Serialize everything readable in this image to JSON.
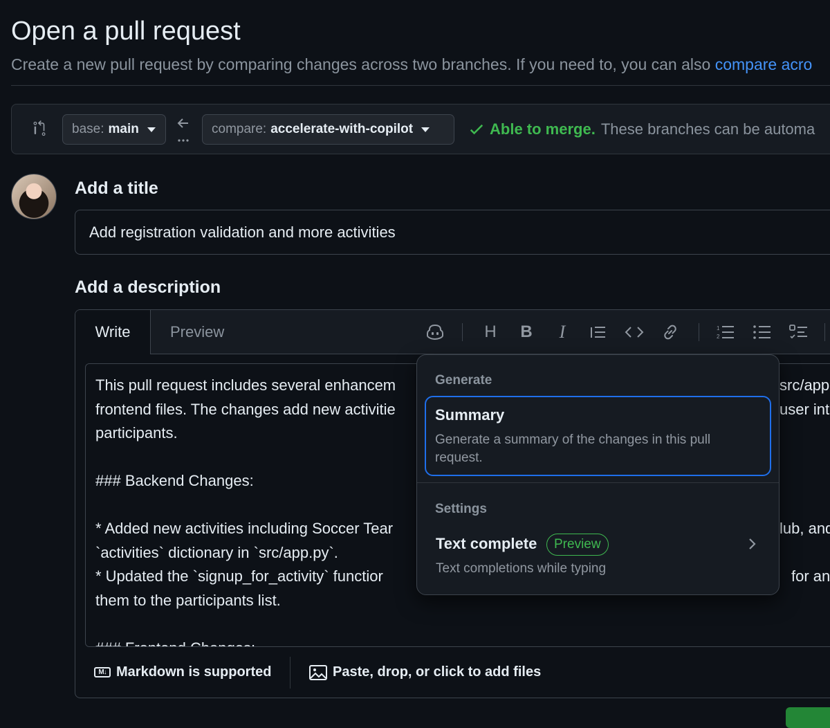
{
  "header": {
    "title": "Open a pull request",
    "subtitle_text": "Create a new pull request by comparing changes across two branches. If you need to, you can also ",
    "subtitle_link": "compare acro"
  },
  "compare_bar": {
    "base_key": "base:",
    "base_value": "main",
    "compare_key": "compare:",
    "compare_value": "accelerate-with-copilot",
    "status_ok": "Able to merge.",
    "status_rest": "These branches can be automa"
  },
  "title_section": {
    "heading": "Add a title",
    "value": "Add registration validation and more activities"
  },
  "description_section": {
    "heading": "Add a description",
    "tabs": {
      "write": "Write",
      "preview": "Preview"
    },
    "toolbar": {
      "heading": "H",
      "bold": "B",
      "italic": "I"
    },
    "body_lines": [
      "This pull request includes several enhancem",
      "frontend files. The changes add new activitie",
      "participants.",
      "",
      "### Backend Changes:",
      "",
      "* Added new activities including Soccer Tear",
      "`activities` dictionary in `src/app.py`.",
      "* Updated the `signup_for_activity` functior",
      "them to the participants list.",
      "",
      "### Frontend Changes:"
    ],
    "body_right_fragments": [
      "src/app",
      "user into",
      "lub, and",
      "for an"
    ],
    "footer_markdown": "Markdown is supported",
    "footer_files": "Paste, drop, or click to add files"
  },
  "copilot_menu": {
    "generate_label": "Generate",
    "summary_title": "Summary",
    "summary_desc": "Generate a summary of the changes in this pull request.",
    "settings_label": "Settings",
    "text_complete_title": "Text complete",
    "text_complete_badge": "Preview",
    "text_complete_desc": "Text completions while typing"
  }
}
